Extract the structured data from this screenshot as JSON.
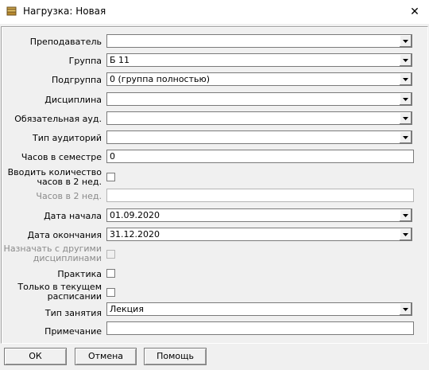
{
  "window": {
    "title": "Нагрузка: Новая",
    "close_glyph": "✕"
  },
  "form": {
    "teacher_label": "Преподаватель",
    "teacher_value": "",
    "group_label": "Группа",
    "group_value": "Б 11",
    "subgroup_label": "Подгруппа",
    "subgroup_value": "0 (группа полностью)",
    "discipline_label": "Дисциплина",
    "discipline_value": "",
    "required_room_label": "Обязательная ауд.",
    "required_room_value": "",
    "room_type_label": "Тип аудиторий",
    "room_type_value": "",
    "hours_semester_label": "Часов в семестре",
    "hours_semester_value": "0",
    "enter_hours_2w_label_1": "Вводить количество",
    "enter_hours_2w_label_2": "часов в 2 нед.",
    "hours_2w_label": "Часов в 2 нед.",
    "hours_2w_value": "",
    "start_date_label": "Дата начала",
    "start_date_value": "01.09.2020",
    "end_date_label": "Дата окончания",
    "end_date_value": "31.12.2020",
    "assign_with_label_1": "Назначать с другими",
    "assign_with_label_2": "дисциплинами",
    "practice_label": "Практика",
    "current_only_label_1": "Только в текущем",
    "current_only_label_2": "расписании",
    "class_type_label": "Тип занятия",
    "class_type_value": "Лекция",
    "note_label": "Примечание",
    "note_value": ""
  },
  "buttons": {
    "ok": "ОК",
    "cancel": "Отмена",
    "help": "Помощь"
  }
}
